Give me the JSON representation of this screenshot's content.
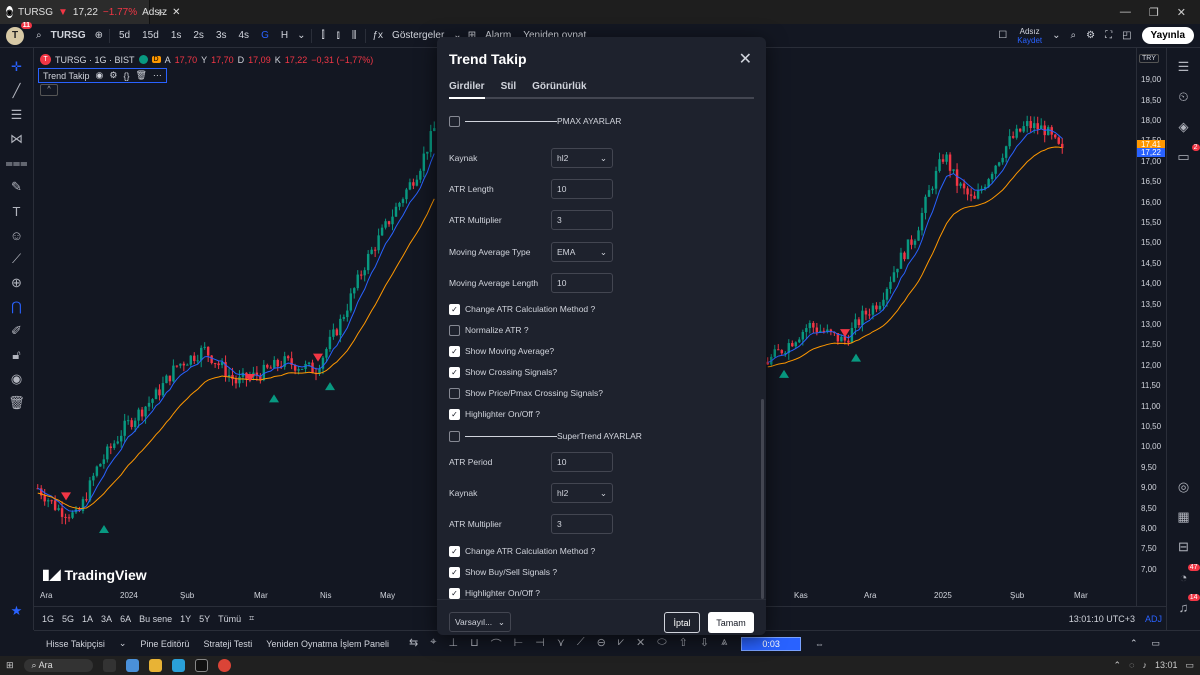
{
  "browser": {
    "tab_title": "TURSG",
    "tab_price": "17,22",
    "tab_change": "−1.77%",
    "tab_user": "Adsız",
    "new_tab": "+"
  },
  "toolbar": {
    "avatar_letter": "T",
    "avatar_badge": "11",
    "symbol": "TURSG",
    "intervals": [
      "5d",
      "15d",
      "1s",
      "2s",
      "3s",
      "4s",
      "G",
      "H"
    ],
    "active_interval": "G",
    "indicators": "Göstergeler",
    "alarm": "Alarm",
    "replay": "Yeniden oynat",
    "user_name": "Adsız",
    "user_save": "Kaydet",
    "publish": "Yayınla"
  },
  "legend": {
    "symbol_logo": "T",
    "title": "TURSG · 1G · BIST",
    "d_badge": "D",
    "o_label": "A",
    "o_value": "17,70",
    "h_label": "Y",
    "h_value": "17,70",
    "l_label": "D",
    "l_value": "17,09",
    "c_label": "K",
    "c_value": "17,22",
    "change": "−0,31 (−1,77%)",
    "indicator_name": "Trend Takip"
  },
  "watermark": "TradingView",
  "chart_data": {
    "type": "candlestick",
    "x_ticks": [
      "Ara",
      "2024",
      "Şub",
      "Mar",
      "Nis",
      "May",
      "Kas",
      "Ara",
      "2025",
      "Şub",
      "Mar"
    ],
    "y_ticks": [
      "19,00",
      "18,50",
      "18,00",
      "17,50",
      "17,00",
      "16,50",
      "16,00",
      "15,50",
      "15,00",
      "14,50",
      "14,00",
      "13,50",
      "13,00",
      "12,50",
      "12,00",
      "11,50",
      "11,00",
      "10,50",
      "10,00",
      "9,50",
      "9,00",
      "8,50",
      "8,00",
      "7,50",
      "7,00"
    ],
    "ylim": [
      6.8,
      19.25
    ],
    "last_price": "17,22",
    "ma_price": "17,41",
    "currency": "TRY",
    "left_segment": {
      "start": 8.9,
      "end": 17.8,
      "points": [
        [
          0,
          9.0
        ],
        [
          0.05,
          8.5
        ],
        [
          0.1,
          8.3
        ],
        [
          0.15,
          9.5
        ],
        [
          0.22,
          10.5
        ],
        [
          0.3,
          11.3
        ],
        [
          0.35,
          12.0
        ],
        [
          0.42,
          12.4
        ],
        [
          0.5,
          11.6
        ],
        [
          0.56,
          11.8
        ],
        [
          0.62,
          12.1
        ],
        [
          0.7,
          11.9
        ],
        [
          0.76,
          13.0
        ],
        [
          0.83,
          14.6
        ],
        [
          0.9,
          15.8
        ],
        [
          0.96,
          16.8
        ],
        [
          1.0,
          17.8
        ]
      ]
    },
    "right_segment": {
      "points": [
        [
          0,
          12.1
        ],
        [
          0.08,
          12.6
        ],
        [
          0.14,
          13.0
        ],
        [
          0.2,
          12.8
        ],
        [
          0.26,
          12.6
        ],
        [
          0.32,
          13.2
        ],
        [
          0.38,
          13.6
        ],
        [
          0.44,
          14.5
        ],
        [
          0.5,
          15.2
        ],
        [
          0.55,
          16.3
        ],
        [
          0.6,
          17.2
        ],
        [
          0.64,
          16.5
        ],
        [
          0.7,
          16.0
        ],
        [
          0.76,
          16.8
        ],
        [
          0.82,
          17.5
        ],
        [
          0.88,
          17.9
        ],
        [
          0.94,
          17.8
        ],
        [
          1.0,
          17.22
        ]
      ]
    },
    "up_signals": [
      [
        0.12,
        8.1
      ],
      [
        0.46,
        11.3
      ],
      [
        0.58,
        11.6
      ],
      [
        0.97,
        11.9
      ],
      [
        0.88,
        12.3
      ]
    ],
    "down_signals": [
      [
        0.06,
        8.9
      ],
      [
        0.42,
        11.8
      ],
      [
        0.54,
        12.3
      ],
      [
        0.85,
        12.9
      ]
    ],
    "colors": {
      "up": "#089981",
      "down": "#f23645",
      "ma_fast": "#2962ff",
      "ma_slow": "#ff9800"
    }
  },
  "range_bar": {
    "ranges": [
      "1G",
      "5G",
      "1A",
      "3A",
      "6A",
      "Bu sene",
      "1Y",
      "5Y",
      "Tümü"
    ],
    "clock": "13:01:10 UTC+3",
    "adj": "ADJ"
  },
  "bottom_panel": {
    "items": [
      "Hisse Takipçisi",
      "Pine Editörü",
      "Strateji Testi",
      "Yeniden Oynatma İşlem Paneli"
    ],
    "replay_time": "0:03"
  },
  "taskbar": {
    "search": "Ara",
    "time": "13:01"
  },
  "right_badges": {
    "chat": "2",
    "notifications": "47",
    "alerts": "14"
  },
  "dialog": {
    "title": "Trend Takip",
    "tabs": [
      "Girdiler",
      "Stil",
      "Görünürlük"
    ],
    "active_tab": "Girdiler",
    "rows": {
      "pmax_header": "PMAX AYARLAR",
      "source_label": "Kaynak",
      "source_value": "hl2",
      "atr_length_label": "ATR Length",
      "atr_length_value": "10",
      "atr_mult_label": "ATR Multiplier",
      "atr_mult_value": "3",
      "ma_type_label": "Moving Average Type",
      "ma_type_value": "EMA",
      "ma_length_label": "Moving Average Length",
      "ma_length_value": "10",
      "change_atr_label": "Change ATR Calculation Method ?",
      "normalize_atr_label": "Normalize ATR ?",
      "show_ma_label": "Show Moving Average?",
      "show_cross_label": "Show Crossing Signals?",
      "show_price_pmax_label": "Show Price/Pmax Crossing Signals?",
      "highlighter1_label": "Highlighter On/Off ?",
      "st_header": "SuperTrend AYARLAR",
      "atr_period_label": "ATR Period",
      "atr_period_value": "10",
      "source2_label": "Kaynak",
      "source2_value": "hl2",
      "atr_mult2_label": "ATR Multiplier",
      "atr_mult2_value": "3",
      "change_atr2_label": "Change ATR Calculation Method ?",
      "show_buy_sell_label": "Show Buy/Sell Signals ?",
      "highlighter2_label": "Highlighter On/Off ?"
    },
    "footer": {
      "defaults": "Varsayıl...",
      "cancel": "İptal",
      "ok": "Tamam"
    }
  }
}
